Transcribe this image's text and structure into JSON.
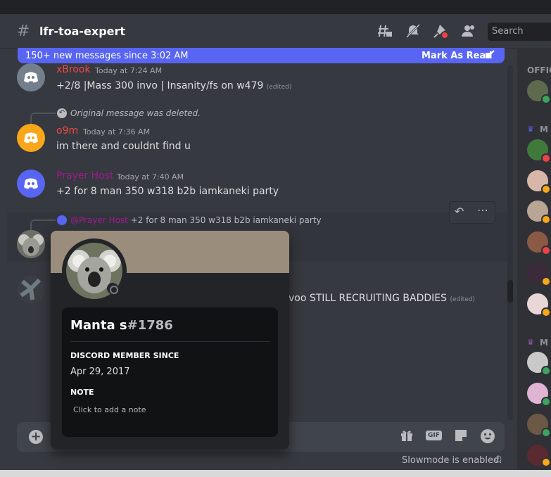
{
  "channel": {
    "name": "lfr-toa-expert"
  },
  "header_icons": [
    "threads-icon",
    "mute-icon",
    "pin-icon",
    "members-icon"
  ],
  "search": {
    "placeholder": "Search"
  },
  "new_messages": {
    "text": "150+ new messages since 3:02 AM",
    "mark_read": "Mark As Read"
  },
  "messages": [
    {
      "username": "xBrook",
      "name_color": "#f04747",
      "timestamp": "Today at 7:24 AM",
      "text": "+2/8 |Mass 300 invo | Insanity/fs on w479",
      "edited": "(edited)",
      "avatar_color": "#747f8d"
    },
    {
      "reply_text": "Original message was deleted.",
      "username": "o9m",
      "name_color": "#f04747",
      "timestamp": "Today at 7:36 AM",
      "text": "im there and couldnt find u",
      "avatar_color": "#faa61a"
    },
    {
      "username": "Prayer Host",
      "name_color": "#a0198f",
      "timestamp": "Today at 7:40 AM",
      "text": "+2 for 8 man 350 w318 b2b iamkaneki party",
      "avatar_color": "#5865f2"
    },
    {
      "reply_mention": "@Prayer Host",
      "reply_text": "+2 for 8 man 350 w318 b2b iamkaneki party"
    },
    {
      "text": "voo STILL RECRUITING BADDIES",
      "edited": "(edited)"
    }
  ],
  "member_list": {
    "section1": "OFFIC",
    "section2": "M",
    "section3": "M"
  },
  "composer": {
    "slowmode": "Slowmode is enabled.",
    "gif_label": "GIF"
  },
  "profile": {
    "display_name": "Manta s",
    "tag": "#1786",
    "member_since_heading": "DISCORD MEMBER SINCE",
    "member_since": "Apr 29, 2017",
    "note_heading": "NOTE",
    "note_placeholder": "Click to add a note",
    "banner_color": "#9b8d7c"
  },
  "colors": {
    "accent": "#5865f2",
    "background": "#36393f",
    "sidebar": "#2f3136"
  }
}
